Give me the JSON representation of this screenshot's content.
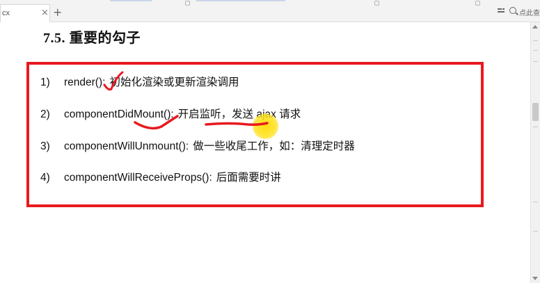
{
  "tabbar": {
    "tab_label": "cx",
    "close_glyph": "×",
    "new_tab_glyph": "+",
    "search_text": "点此查"
  },
  "document": {
    "heading": "7.5.  重要的勾子",
    "items": [
      {
        "num": "1)",
        "code": "render():",
        "desc": "初始化渲染或更新渲染调用"
      },
      {
        "num": "2)",
        "code": "componentDidMount():",
        "desc": "开启监听，发送 ajax 请求"
      },
      {
        "num": "3)",
        "code": "componentWillUnmount():",
        "desc": "做一些收尾工作，如：清理定时器"
      },
      {
        "num": "4)",
        "code": "componentWillReceiveProps():",
        "desc": "后面需要时讲"
      }
    ]
  },
  "colors": {
    "highlight_box": "#e8191f",
    "annotation_ink": "#e8191f",
    "cursor": "#ffdd00"
  },
  "icons": [
    "close-icon",
    "plus-icon",
    "toolbar-icon",
    "search-icon",
    "scroll-up-arrow",
    "scroll-down-arrow"
  ]
}
